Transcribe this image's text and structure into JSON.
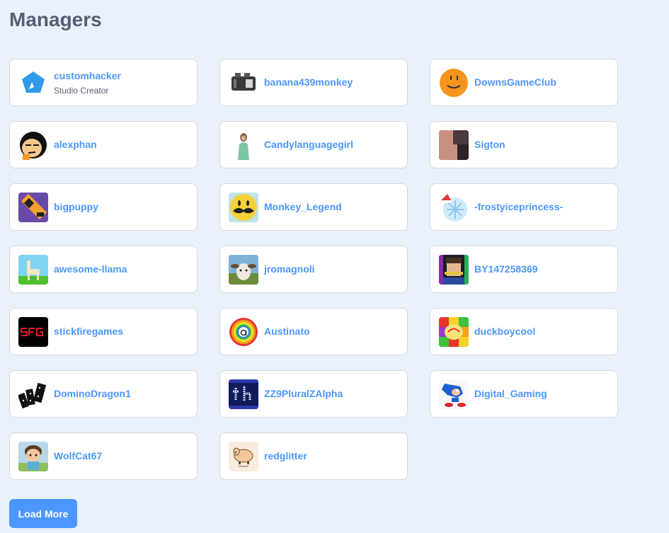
{
  "page": {
    "title": "Managers"
  },
  "managers": [
    {
      "username": "customhacker",
      "role": "Studio Creator",
      "avatar": "blue-pentagon-icon"
    },
    {
      "username": "banana439monkey",
      "role": "",
      "avatar": "toaster-icon"
    },
    {
      "username": "DownsGameClub",
      "role": "",
      "avatar": "orange-smiley-icon"
    },
    {
      "username": "alexphan",
      "role": "",
      "avatar": "cartoon-face-icon"
    },
    {
      "username": "Candylanguagegirl",
      "role": "",
      "avatar": "girl-figure-icon"
    },
    {
      "username": "Sigton",
      "role": "",
      "avatar": "dark-photo-icon"
    },
    {
      "username": "bigpuppy",
      "role": "",
      "avatar": "pixel-tool-icon"
    },
    {
      "username": "Monkey_Legend",
      "role": "",
      "avatar": "mustache-smiley-icon"
    },
    {
      "username": "-frostyiceprincess-",
      "role": "",
      "avatar": "snowflake-santa-hat-icon"
    },
    {
      "username": "awesome-llama",
      "role": "",
      "avatar": "pixel-llama-icon"
    },
    {
      "username": "jromagnoli",
      "role": "",
      "avatar": "goat-photo-icon"
    },
    {
      "username": "BY147258369",
      "role": "",
      "avatar": "pixel-person-icon"
    },
    {
      "username": "stickfiregames",
      "role": "",
      "avatar": "sfg-logo-icon"
    },
    {
      "username": "Austinato",
      "role": "",
      "avatar": "rainbow-letter-a-icon"
    },
    {
      "username": "duckboycool",
      "role": "",
      "avatar": "rainbow-pattern-icon"
    },
    {
      "username": "DominoDragon1",
      "role": "",
      "avatar": "dominoes-icon"
    },
    {
      "username": "ZZ9PluralZAlpha",
      "role": "",
      "avatar": "pixel-th-icon"
    },
    {
      "username": "Digital_Gaming",
      "role": "",
      "avatar": "sonic-icon"
    },
    {
      "username": "WolfCat67",
      "role": "",
      "avatar": "cartoon-kid-icon"
    },
    {
      "username": "redglitter",
      "role": "",
      "avatar": "doge-sketch-icon"
    }
  ],
  "load_more_label": "Load More",
  "colors": {
    "background": "#e9f1fc",
    "link": "#4c97ff",
    "title": "#575e75",
    "button": "#4c97ff"
  }
}
